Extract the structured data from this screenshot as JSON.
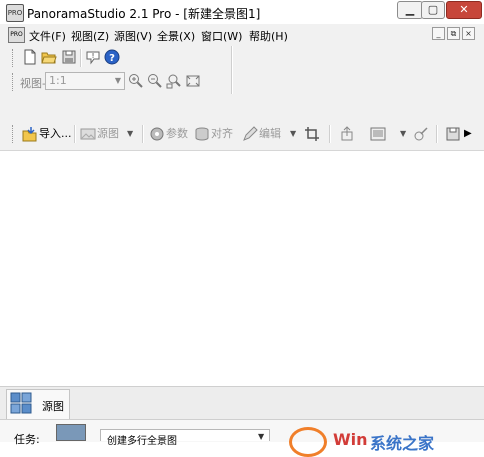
{
  "window": {
    "title": "PanoramaStudio 2.1 Pro - [新建全景图1]",
    "app_icon_text": "PRO",
    "controls": {
      "minimize": "▁",
      "maximize": "▢",
      "close": "✕"
    }
  },
  "menu": {
    "items": [
      "文件(F)",
      "视图(Z)",
      "源图(V)",
      "全景(X)",
      "窗口(W)",
      "帮助(H)"
    ],
    "mdi": [
      "_",
      "⧉",
      "×"
    ]
  },
  "toolbar_view": {
    "label": "视图-",
    "zoom": "1:1"
  },
  "toolbar_main": {
    "import": "导入...",
    "source": "源图",
    "params": "参数",
    "align": "对齐",
    "edit": "编辑"
  },
  "dock": {
    "tab_label": "源图",
    "task_label": "任务:",
    "task_value": "创建多行全景图"
  },
  "watermark": {
    "text1": "Win",
    "text2": "系统之家"
  },
  "colors": {
    "close_button": "#c7463a",
    "toolbar_bg": "#f1f1f1",
    "watermark_orange": "#f07f2a",
    "watermark_red": "#d23c38",
    "watermark_blue": "#3a74c8"
  }
}
